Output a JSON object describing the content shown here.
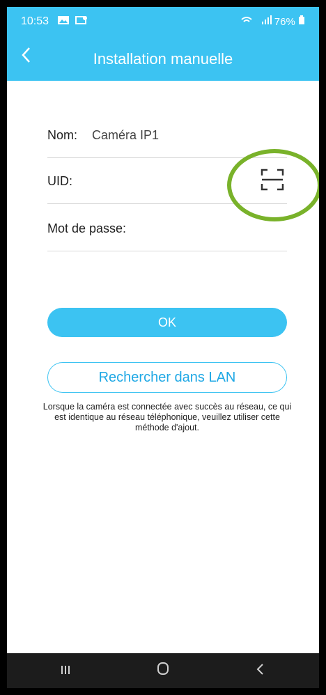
{
  "status_bar": {
    "time": "10:53",
    "battery": "76%"
  },
  "header": {
    "title": "Installation manuelle"
  },
  "form": {
    "name_label": "Nom:",
    "name_value": "Caméra IP1",
    "uid_label": "UID:",
    "password_label": "Mot de passe:"
  },
  "buttons": {
    "ok_label": "OK",
    "lan_label": "Rechercher dans LAN"
  },
  "note": "Lorsque la caméra est connectée avec succès au réseau, ce qui est identique au réseau téléphonique, veuillez utiliser cette méthode d'ajout.",
  "colors": {
    "accent": "#3cc3f2",
    "highlight_circle": "#79b22a"
  },
  "icons": {
    "back": "chevron-left-icon",
    "scan": "qr-scan-icon",
    "nav_recents": "recents-icon",
    "nav_home": "home-icon",
    "nav_back": "back-icon"
  }
}
